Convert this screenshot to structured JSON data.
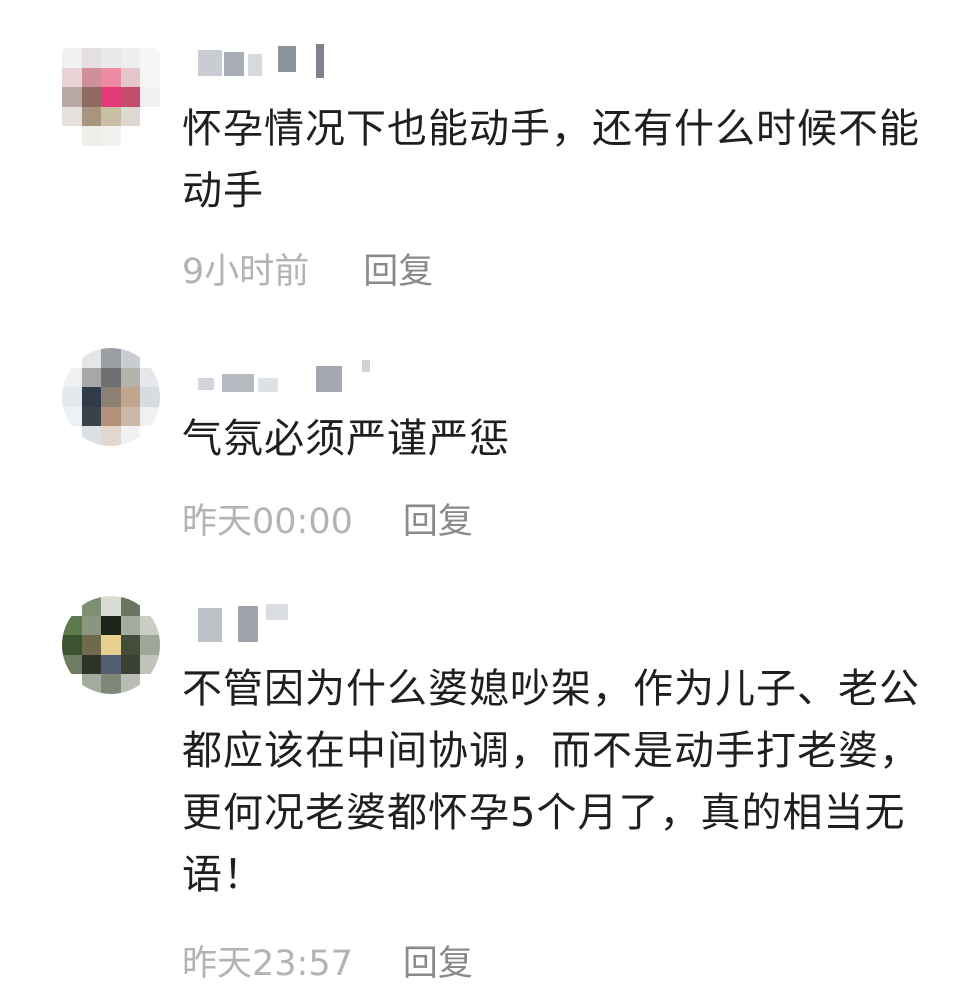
{
  "comments": [
    {
      "text": "怀孕情况下也能动手，还有什么时候不能动手",
      "time": "9小时前",
      "reply_label": "回复",
      "avatar_pixels": [
        "#f1f1f1",
        "#e6dfe2",
        "#e9e9e9",
        "#efefef",
        "#f6f6f6",
        "#e8d3d7",
        "#cf8f9b",
        "#ee8aa2",
        "#e4c6cd",
        "#f5f5f5",
        "#b9a8a6",
        "#8f6a62",
        "#e53a78",
        "#c24d6a",
        "#f0f0f0",
        "#e4e0dc",
        "#a79580",
        "#c8bfa5",
        "#ddd8d0",
        "#ffffff",
        "#ffffff",
        "#efeeea",
        "#f3f1ee",
        "#ffffff",
        "#ffffff"
      ]
    },
    {
      "text": "气氛必须严谨严惩",
      "time": "昨天00:00",
      "reply_label": "回复",
      "avatar_pixels": [
        "#ffffff",
        "#e4e6e8",
        "#9aa0a6",
        "#c9cdd1",
        "#ffffff",
        "#eef0f2",
        "#a6a7a9",
        "#6d6f71",
        "#b5b1ab",
        "#e5e7ea",
        "#e4e8ed",
        "#2f3b4a",
        "#8d7f74",
        "#c2a58d",
        "#d8dce1",
        "#eef1f4",
        "#39414d",
        "#b48f79",
        "#cbb8a6",
        "#eef0f2",
        "#ffffff",
        "#dcdfe3",
        "#e1d7ce",
        "#f1f1f1",
        "#ffffff"
      ]
    },
    {
      "text": "不管因为什么婆媳吵架，作为儿子、老公都应该在中间协调，而不是动手打老婆，更何况老婆都怀孕5个月了，真的相当无语！",
      "time": "昨天23:57",
      "reply_label": "回复",
      "avatar_pixels": [
        "#ffffff",
        "#7f8f72",
        "#d9ddd6",
        "#6b7363",
        "#ffffff",
        "#5d7a4d",
        "#8c957f",
        "#1d2418",
        "#a5ab9f",
        "#c9cdc3",
        "#3b5330",
        "#6f6a4d",
        "#e6d28e",
        "#434d3b",
        "#9ea697",
        "#6d7c63",
        "#2d3529",
        "#525f73",
        "#394133",
        "#c0c4ba",
        "#ffffff",
        "#a5ab9e",
        "#7f8777",
        "#b8bcb2",
        "#ffffff"
      ]
    }
  ]
}
